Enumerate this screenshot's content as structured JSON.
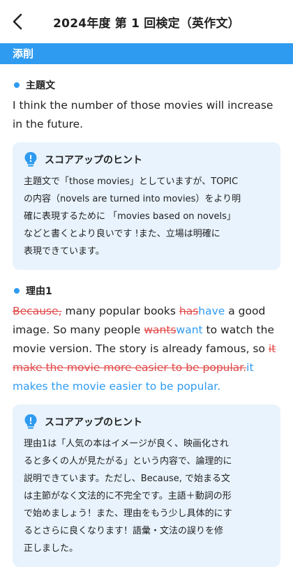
{
  "header": {
    "title": "2024年度 第 1 回検定（英作文）"
  },
  "section_bar": {
    "label": "添削"
  },
  "theme": {
    "label": "主題文",
    "text": "I think the number of those movies will increase in the future.",
    "hint": {
      "title": "スコアアップのヒント",
      "lines": [
        "主題文で「those movies」としていますが、TOPIC",
        "の内容（novels are turned into movies）をより明",
        "確に表現するために 「movies based on novels」",
        "などと書くとより良いです !また、立場は明確に",
        "表現できています。"
      ]
    }
  },
  "reason1": {
    "label": "理由1",
    "segments": {
      "s1_del": "Because,",
      "s2": " many popular books ",
      "s3_del": "has",
      "s4_ins": "have",
      "s5": " a good image. So many people ",
      "s6_del": "wants",
      "s7_ins": "want",
      "s8": " to watch the movie version. The story is already famous, so ",
      "s9_del": "it make the movie more easier to be popular.",
      "s10_ins": "it makes the movie easier to be popular."
    },
    "hint": {
      "title": "スコアアップのヒント",
      "lines": [
        "理由1は「人気の本はイメージが良く、映画化され",
        "ると多くの人が見たがる」という内容で、論理的に",
        "説明できています。ただし、Because, で始まる文",
        "は主節がなく文法的に不完全です。主語＋動詞の形",
        "で始めましょう！また、理由をもう少し具体的にす",
        "るとさらに良くなります！語彙・文法の誤りを修",
        "正しました。"
      ]
    }
  },
  "colors": {
    "accent": "#2e9bf0",
    "error": "#e04848",
    "hint_bg": "#e8f3fd"
  },
  "icons": {
    "back": "chevron-left-icon",
    "hint": "lightbulb-icon"
  }
}
